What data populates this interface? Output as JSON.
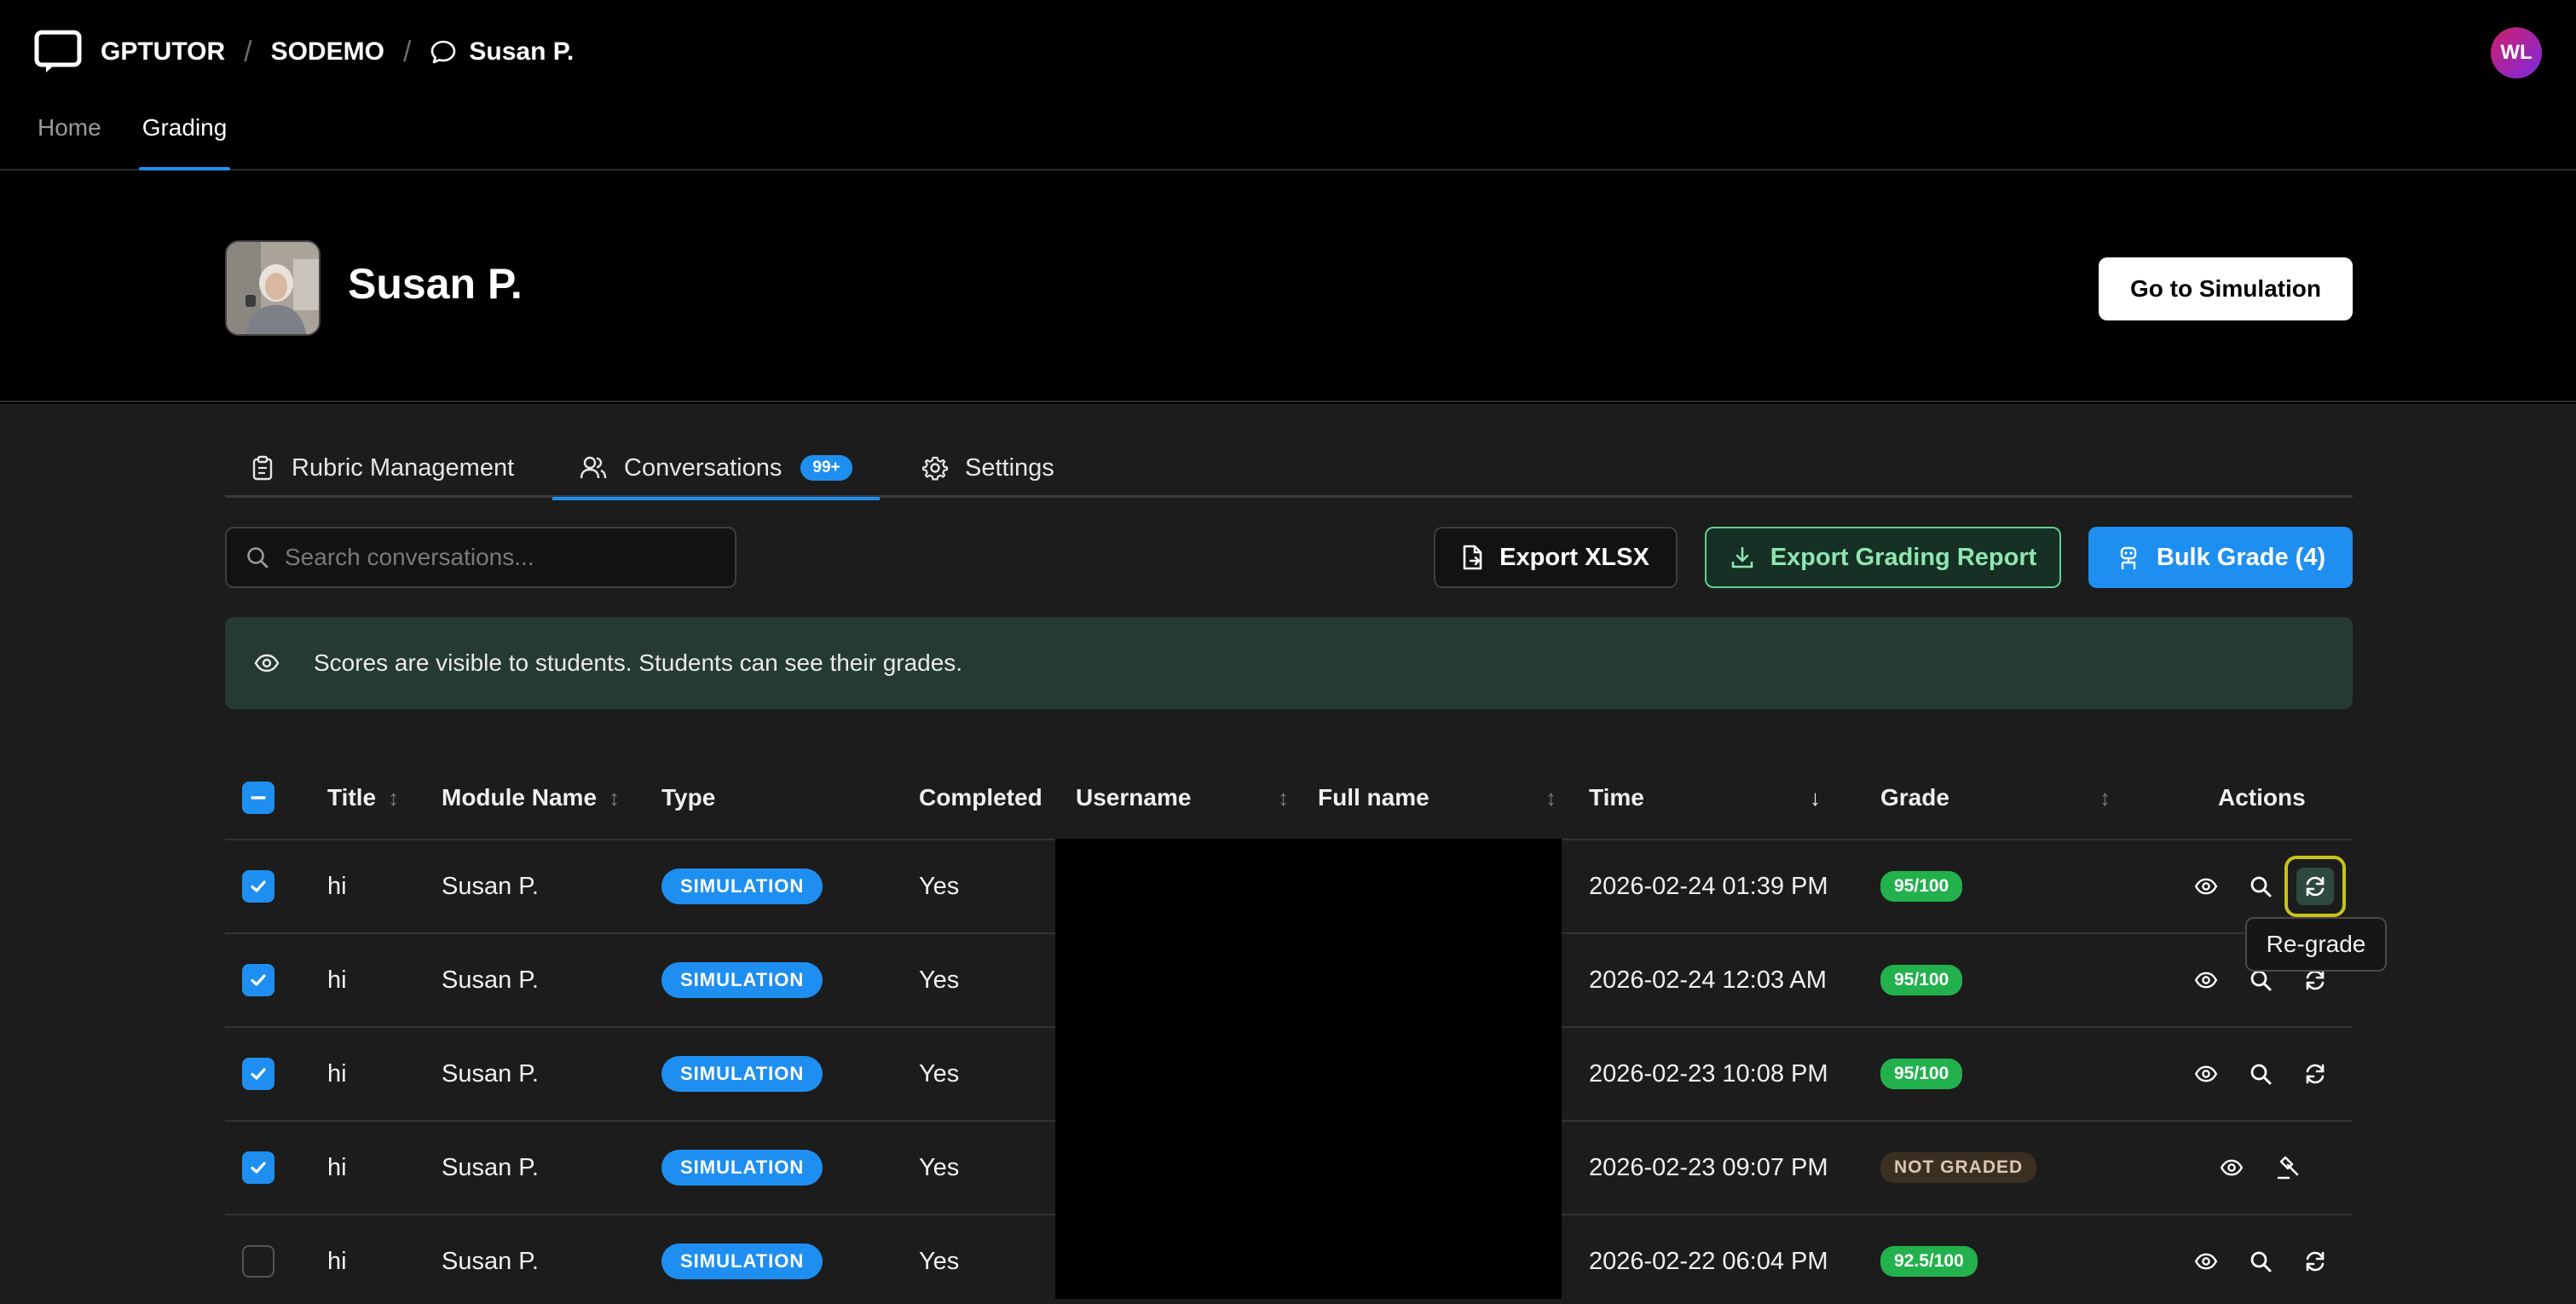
{
  "header": {
    "brand": "GPTUTOR",
    "org": "SODEMO",
    "bot_name": "Susan P.",
    "user_initials": "WL",
    "nav": [
      {
        "label": "Home"
      },
      {
        "label": "Grading"
      }
    ]
  },
  "hero": {
    "name": "Susan P.",
    "go_button": "Go to Simulation"
  },
  "tabs": {
    "rubric": "Rubric Management",
    "conversations": "Conversations",
    "conversations_badge": "99+",
    "settings": "Settings"
  },
  "toolbar": {
    "search_placeholder": "Search conversations...",
    "export_xlsx": "Export XLSX",
    "export_report": "Export Grading Report",
    "bulk_grade": "Bulk Grade (4)"
  },
  "notice": "Scores are visible to students. Students can see their grades.",
  "table": {
    "headers": {
      "title": "Title",
      "module": "Module Name",
      "type": "Type",
      "completed": "Completed",
      "username": "Username",
      "fullname": "Full name",
      "time": "Time",
      "grade": "Grade",
      "actions": "Actions"
    },
    "rows": [
      {
        "checked": true,
        "title": "hi",
        "module": "Susan P.",
        "type": "SIMULATION",
        "completed": "Yes",
        "time": "2026-02-24 01:39 PM",
        "grade": "95/100"
      },
      {
        "checked": true,
        "title": "hi",
        "module": "Susan P.",
        "type": "SIMULATION",
        "completed": "Yes",
        "time": "2026-02-24 12:03 AM",
        "grade": "95/100"
      },
      {
        "checked": true,
        "title": "hi",
        "module": "Susan P.",
        "type": "SIMULATION",
        "completed": "Yes",
        "time": "2026-02-23 10:08 PM",
        "grade": "95/100"
      },
      {
        "checked": true,
        "title": "hi",
        "module": "Susan P.",
        "type": "SIMULATION",
        "completed": "Yes",
        "time": "2026-02-23 09:07 PM",
        "grade": "NOT GRADED"
      },
      {
        "checked": false,
        "title": "hi",
        "module": "Susan P.",
        "type": "SIMULATION",
        "completed": "Yes",
        "time": "2026-02-22 06:04 PM",
        "grade": "92.5/100"
      }
    ]
  },
  "tooltip": "Re-grade",
  "colors": {
    "accent": "#1e8ff0",
    "grade_green": "#22b14c",
    "notice_bg": "#253a32",
    "highlight": "#c8c21a"
  },
  "icons": {
    "logo": "chat-screen-icon",
    "breadcrumb": "chat-bubble-icon",
    "rubric": "clipboard-icon",
    "conversations": "users-icon",
    "settings": "gear-icon",
    "search": "search-icon",
    "xlsx": "file-export-icon",
    "report": "download-icon",
    "bulk": "robot-icon",
    "notice": "eye-icon",
    "view": "eye-icon",
    "inspect": "search-icon",
    "regrade": "refresh-icon",
    "grade": "gavel-icon"
  }
}
